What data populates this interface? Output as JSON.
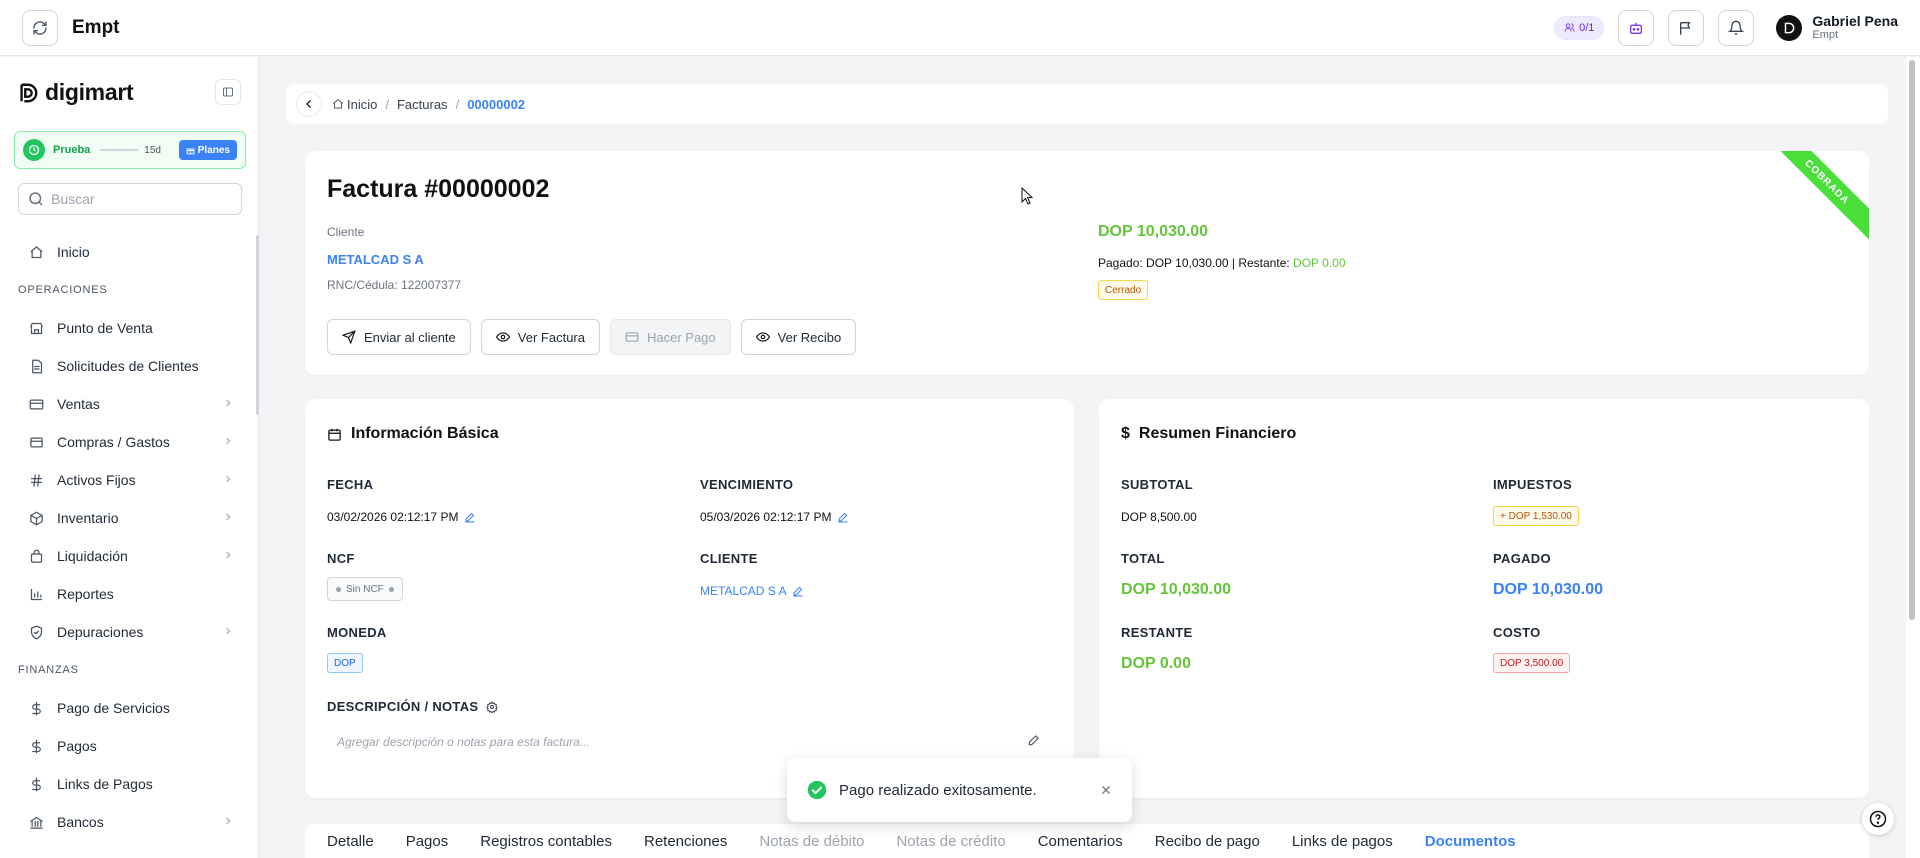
{
  "topbar": {
    "title": "Empt",
    "users_pill": "0/1",
    "user_name": "Gabriel Pena",
    "user_company": "Empt"
  },
  "sidebar": {
    "brand": "digimart",
    "trial": {
      "label": "Prueba",
      "days": "15d",
      "plans_label": "Planes"
    },
    "search_placeholder": "Buscar",
    "home": "Inicio",
    "section_operations": "OPERACIONES",
    "operations": [
      {
        "label": "Punto de Venta",
        "icon": "store-icon",
        "chevron": false
      },
      {
        "label": "Solicitudes de Clientes",
        "icon": "document-icon",
        "chevron": false
      },
      {
        "label": "Ventas",
        "icon": "card-icon",
        "chevron": true
      },
      {
        "label": "Compras / Gastos",
        "icon": "cart-icon",
        "chevron": true
      },
      {
        "label": "Activos Fijos",
        "icon": "hash-icon",
        "chevron": true
      },
      {
        "label": "Inventario",
        "icon": "box-icon",
        "chevron": true
      },
      {
        "label": "Liquidación",
        "icon": "bag-icon",
        "chevron": true
      },
      {
        "label": "Reportes",
        "icon": "chart-icon",
        "chevron": false
      },
      {
        "label": "Depuraciones",
        "icon": "shield-icon",
        "chevron": true
      }
    ],
    "section_finance": "FINANZAS",
    "finance": [
      {
        "label": "Pago de Servicios",
        "icon": "dollar-icon",
        "chevron": false
      },
      {
        "label": "Pagos",
        "icon": "dollar-icon",
        "chevron": false
      },
      {
        "label": "Links de Pagos",
        "icon": "dollar-icon",
        "chevron": false
      },
      {
        "label": "Bancos",
        "icon": "bank-icon",
        "chevron": true
      }
    ]
  },
  "breadcrumb": {
    "home": "Inicio",
    "section": "Facturas",
    "current": "00000002"
  },
  "invoice": {
    "title": "Factura #00000002",
    "client_label": "Cliente",
    "client_name": "METALCAD S A",
    "rnc": "RNC/Cédula: 122007377",
    "amount": "DOP 10,030.00",
    "paid_text": "Pagado: DOP 10,030.00 | Restante:",
    "remaining": "DOP 0.00",
    "status_badge": "Cerrado",
    "ribbon": "COBRADA",
    "buttons": {
      "send": "Enviar al cliente",
      "view_invoice": "Ver Factura",
      "pay": "Hacer Pago",
      "view_receipt": "Ver Recibo"
    }
  },
  "basic": {
    "title": "Información Básica",
    "date_label": "FECHA",
    "date_value": "03/02/2026 02:12:17 PM",
    "due_label": "VENCIMIENTO",
    "due_value": "05/03/2026 02:12:17 PM",
    "ncf_label": "NCF",
    "ncf_value": "Sin NCF",
    "client_label": "CLIENTE",
    "client_value": "METALCAD S A",
    "currency_label": "MONEDA",
    "currency_value": "DOP",
    "notes_label": "DESCRIPCIÓN / NOTAS",
    "notes_placeholder": "Agregar descripción o notas para esta factura..."
  },
  "financial": {
    "title": "Resumen Financiero",
    "subtotal_label": "SUBTOTAL",
    "subtotal_value": "DOP 8,500.00",
    "taxes_label": "IMPUESTOS",
    "taxes_value": "+ DOP 1,530.00",
    "total_label": "TOTAL",
    "total_value": "DOP 10,030.00",
    "paid_label": "PAGADO",
    "paid_value": "DOP 10,030.00",
    "remaining_label": "RESTANTE",
    "remaining_value": "DOP 0.00",
    "cost_label": "COSTO",
    "cost_value": "DOP 3,500.00"
  },
  "tabs": [
    {
      "label": "Detalle",
      "state": "normal"
    },
    {
      "label": "Pagos",
      "state": "normal"
    },
    {
      "label": "Registros contables",
      "state": "normal"
    },
    {
      "label": "Retenciones",
      "state": "normal"
    },
    {
      "label": "Notas de débito",
      "state": "disabled"
    },
    {
      "label": "Notas de crédito",
      "state": "disabled"
    },
    {
      "label": "Comentarios",
      "state": "normal"
    },
    {
      "label": "Recibo de pago",
      "state": "normal"
    },
    {
      "label": "Links de pagos",
      "state": "normal"
    },
    {
      "label": "Documentos",
      "state": "active"
    }
  ],
  "toast": {
    "message": "Pago realizado exitosamente."
  },
  "colors": {
    "accent": "#3b82f6",
    "success": "#65c53a",
    "ribbon": "#4ade3a"
  }
}
